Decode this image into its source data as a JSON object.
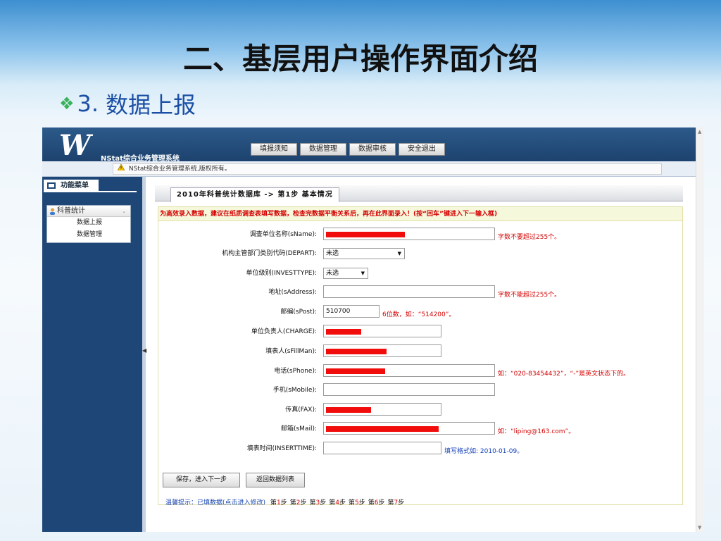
{
  "slide": {
    "title": "二、基层用户操作界面介绍",
    "subtitle_bullet": "❖",
    "subtitle_number": "3.",
    "subtitle_text": "数据上报"
  },
  "app": {
    "logo_text": "W",
    "system_name": "NStat综合业务管理系统",
    "nav": [
      "填报须知",
      "数据管理",
      "数据审核",
      "安全退出"
    ],
    "copyright": "NStat综合业务管理系统,版权所有。",
    "icons": {
      "warning": "warning-icon",
      "monitor": "monitor-icon",
      "user": "user-icon"
    }
  },
  "sidebar": {
    "menu_title": "功能菜单",
    "group": "科普统计",
    "group_chevron": "⌄",
    "items": [
      "数据上报",
      "数据管理"
    ],
    "collapse_arrow": "◀"
  },
  "form": {
    "tab_title": "2010年科普统计数据库 -> 第1步 基本情况",
    "hint": "为高效录入数据，建议在纸质调查表填写数据，检查完数据平衡关系后，再在此界面录入！(按“回车”键进入下一输入框)",
    "fields": [
      {
        "label": "调查单位名称(sName):",
        "value": "",
        "redacted": true,
        "note": "字数不要超过255个。"
      },
      {
        "label": "机构主管部门类别代码(DEPART):",
        "select": "未选"
      },
      {
        "label": "单位级别(INVESTTYPE):",
        "select": "未选"
      },
      {
        "label": "地址(sAddress):",
        "value": "",
        "note": "字数不能超过255个。"
      },
      {
        "label": "邮编(sPost):",
        "value": "510700",
        "note": "6位数，如：“514200”。"
      },
      {
        "label": "单位负责人(CHARGE):",
        "value": "",
        "redacted": true
      },
      {
        "label": "填表人(sFillMan):",
        "value": "",
        "redacted": true
      },
      {
        "label": "电话(sPhone):",
        "value": "",
        "redacted": true,
        "note": "如：“020-83454432”，“-”是英文状态下的。"
      },
      {
        "label": "手机(sMobile):",
        "value": ""
      },
      {
        "label": "传真(FAX):",
        "value": "",
        "redacted": true
      },
      {
        "label": "邮箱(sMail):",
        "value": "",
        "redacted": true,
        "note": "如：“liping@163.com”。"
      },
      {
        "label": "填表时间(INSERTTIME):",
        "value": "",
        "note": "填写格式如: 2010-01-09。"
      }
    ],
    "save_button": "保存，进入下一步",
    "back_button": "返回数据列表",
    "steps_intro": "温馨提示：",
    "steps_filled": "已填数据(点击进入修改)",
    "steps": [
      {
        "prefix": "第",
        "n": "1",
        "suffix": "步"
      },
      {
        "prefix": "第",
        "n": "2",
        "suffix": "步"
      },
      {
        "prefix": "第",
        "n": "3",
        "suffix": "步"
      },
      {
        "prefix": "第",
        "n": "4",
        "suffix": "步"
      },
      {
        "prefix": "第",
        "n": "5",
        "suffix": "步"
      },
      {
        "prefix": "第",
        "n": "6",
        "suffix": "步"
      },
      {
        "prefix": "第",
        "n": "7",
        "suffix": "步"
      }
    ]
  }
}
